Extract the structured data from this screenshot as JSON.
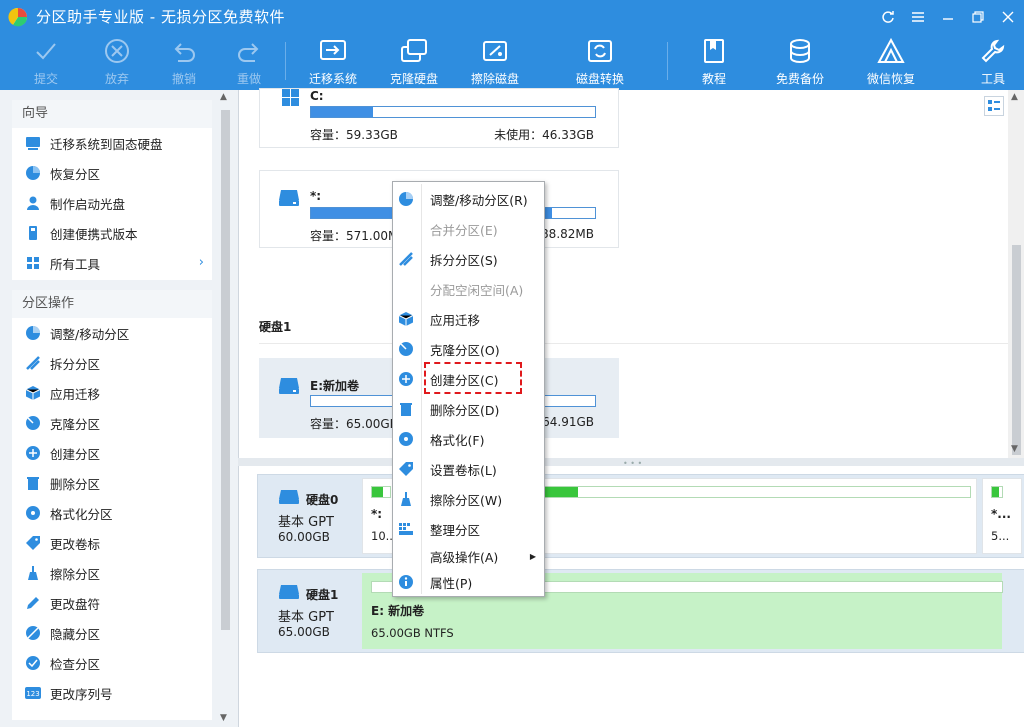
{
  "window": {
    "title": "分区助手专业版 - 无损分区免费软件"
  },
  "toolbar": {
    "items": [
      {
        "label": "提交",
        "icon": "check-icon"
      },
      {
        "label": "放弃",
        "icon": "discard-icon"
      },
      {
        "label": "撤销",
        "icon": "undo-icon"
      },
      {
        "label": "重做",
        "icon": "redo-icon"
      },
      {
        "label": "迁移系统",
        "icon": "migrate-os-icon"
      },
      {
        "label": "克隆硬盘",
        "icon": "clone-disk-icon"
      },
      {
        "label": "擦除磁盘",
        "icon": "wipe-disk-icon"
      },
      {
        "label": "磁盘转换",
        "icon": "convert-disk-icon"
      },
      {
        "label": "教程",
        "icon": "tutorial-icon"
      },
      {
        "label": "免费备份",
        "icon": "backup-icon"
      },
      {
        "label": "微信恢复",
        "icon": "wechat-recover-icon"
      },
      {
        "label": "工具",
        "icon": "tools-icon"
      }
    ]
  },
  "sidebar": {
    "wizard_title": "向导",
    "wizard_items": [
      {
        "label": "迁移系统到固态硬盘"
      },
      {
        "label": "恢复分区"
      },
      {
        "label": "制作启动光盘"
      },
      {
        "label": "创建便携式版本"
      },
      {
        "label": "所有工具"
      }
    ],
    "ops_title": "分区操作",
    "ops_items": [
      {
        "label": "调整/移动分区"
      },
      {
        "label": "拆分分区"
      },
      {
        "label": "应用迁移"
      },
      {
        "label": "克隆分区"
      },
      {
        "label": "创建分区"
      },
      {
        "label": "删除分区"
      },
      {
        "label": "格式化分区"
      },
      {
        "label": "更改卷标"
      },
      {
        "label": "擦除分区"
      },
      {
        "label": "更改盘符"
      },
      {
        "label": "隐藏分区"
      },
      {
        "label": "检查分区"
      },
      {
        "label": "更改序列号"
      }
    ]
  },
  "partitions": [
    {
      "name": "C:",
      "capacity": "容量：59.33GB",
      "free": "未使用：46.33GB",
      "used_fraction": 0.22
    },
    {
      "name": "*:",
      "capacity": "容量：571.00MB",
      "free": "88.82MB",
      "used_fraction": 0.85
    },
    {
      "name": "E:新加卷",
      "capacity": "容量：65.00GB",
      "free": "64.91GB",
      "used_fraction": 0.0
    }
  ],
  "disk1_title": "硬盘1",
  "disks": [
    {
      "name": "硬盘0",
      "type": "基本 GPT",
      "size": "60.00GB",
      "part1_name": "*:",
      "part1_sub": "10...",
      "part3_name": "*...",
      "part3_sub": "5..."
    },
    {
      "name": "硬盘1",
      "type": "基本 GPT",
      "size": "65.00GB",
      "part_name": "E: 新加卷",
      "part_sub": "65.00GB NTFS"
    }
  ],
  "context_menu": {
    "items": [
      {
        "label": "调整/移动分区(R)",
        "enabled": true
      },
      {
        "label": "合并分区(E)",
        "enabled": false
      },
      {
        "label": "拆分分区(S)",
        "enabled": true
      },
      {
        "label": "分配空闲空间(A)",
        "enabled": false
      },
      {
        "label": "应用迁移",
        "enabled": true
      },
      {
        "label": "克隆分区(O)",
        "enabled": true
      },
      {
        "label": "创建分区(C)",
        "enabled": true,
        "highlighted": true
      },
      {
        "label": "删除分区(D)",
        "enabled": true
      },
      {
        "label": "格式化(F)",
        "enabled": true
      },
      {
        "label": "设置卷标(L)",
        "enabled": true
      },
      {
        "label": "擦除分区(W)",
        "enabled": true
      },
      {
        "label": "整理分区",
        "enabled": true
      },
      {
        "label": "高级操作(A)",
        "enabled": true,
        "submenu": true
      },
      {
        "label": "属性(P)",
        "enabled": true
      }
    ]
  },
  "colors": {
    "accent": "#2e8ddf",
    "bar": "#3f8fe4",
    "green": "#39c63c",
    "highlight": "#e0191c"
  }
}
